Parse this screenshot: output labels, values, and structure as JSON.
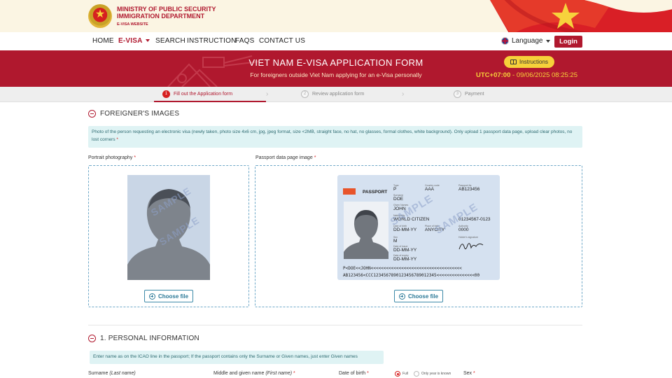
{
  "header": {
    "ministry_line1": "MINISTRY OF PUBLIC SECURITY",
    "ministry_line2": "IMMIGRATION DEPARTMENT",
    "ministry_line3": "E-VISA WEBSITE"
  },
  "nav": {
    "items": [
      "HOME",
      "E-VISA",
      "SEARCH",
      "INSTRUCTION",
      "FAQS",
      "CONTACT US"
    ],
    "active": "E-VISA",
    "language_label": "Language",
    "login_label": "Login"
  },
  "banner": {
    "title": "VIET NAM E-VISA APPLICATION FORM",
    "subtitle": "For foreigners outside Viet Nam applying for an e-Visa personally",
    "instructions_label": "Instructions",
    "timezone": "UTC+07:00",
    "datetime": " - 09/06/2025 08:25:25"
  },
  "stepper": {
    "steps": [
      {
        "num": "1",
        "label": "Fill out the Application form",
        "active": true
      },
      {
        "num": "2",
        "label": "Review application form",
        "active": false
      },
      {
        "num": "3",
        "label": "Payment",
        "active": false
      }
    ]
  },
  "images_section": {
    "title": "FOREIGNER'S IMAGES",
    "note": "Photo of the person requesting an electronic visa (newly taken, photo size 4x6 cm, jpg, jpeg format, size <2MB, straight face, no hat, no glasses, formal clothes, white background). Only upload 1 passport data page, upload clear photos, no lost corners",
    "portrait_label": "Portrait photography",
    "passport_label": "Passport data page image",
    "choose_file_label": "Choose file",
    "sample_watermark": "SAMPLE"
  },
  "passport_sample": {
    "doc_title": "PASSPORT",
    "type_label": "Type",
    "type": "P",
    "country_label": "Country code",
    "country": "AAA",
    "number_label": "Passport №",
    "number": "AB123456",
    "surname_label": "Surname",
    "surname": "DOE",
    "given_label": "Given Names",
    "given": "JOHN",
    "nationality_label": "Nationality",
    "nationality": "WORLD CITIZEN",
    "personal_no": "01234567-0123",
    "dob_label": "Date of birth",
    "dob": "DD-MM-YY",
    "pob_label": "Place of birth",
    "pob": "ANYCITY",
    "authority_label": "Authority",
    "authority": "0000",
    "sex_label": "Sex",
    "sex": "M",
    "holder_sig_label": "Holder's signature",
    "issue_label": "Date of issue",
    "issue": "DD-MM-YY",
    "expiry_label": "Date of expiry",
    "expiry": "DD-MM-YY",
    "mrz1": "P<DOE<<JOHN<<<<<<<<<<<<<<<<<<<<<<<<<<<<<<<<<<<<",
    "mrz2": "AB123456<CCC1234567890123456789012345<<<<<<<<<<<<<<<00"
  },
  "personal_section": {
    "title": "1. PERSONAL INFORMATION",
    "note": "Enter name as on the ICAO line in the passport; If the passport contains only the Surname or Given names, just enter Given names",
    "surname_label": "Surname",
    "surname_hint": "(Last name)",
    "middle_given_label": "Middle and given name",
    "middle_given_hint": "(First name)",
    "dob_label": "Date of birth",
    "dob_full": "Full",
    "dob_year_only": "Only year is known",
    "sex_label": "Sex"
  },
  "colors": {
    "brand_red": "#b0182e",
    "accent_yellow": "#f6d13a",
    "note_bg": "#dff3f4",
    "upload_border": "#6fa8c8"
  }
}
